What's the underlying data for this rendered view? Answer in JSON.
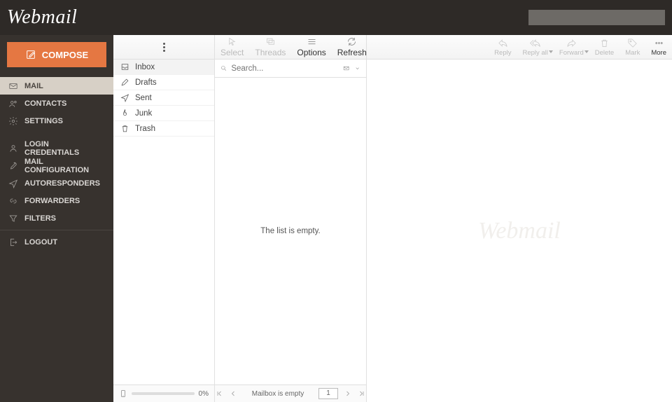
{
  "header": {
    "logo": "Webmail"
  },
  "compose": {
    "label": "COMPOSE"
  },
  "sidebar": {
    "primary": [
      {
        "label": "MAIL",
        "active": true
      },
      {
        "label": "CONTACTS"
      },
      {
        "label": "SETTINGS"
      }
    ],
    "secondary": [
      {
        "label": "LOGIN CREDENTIALS"
      },
      {
        "label": "MAIL CONFIGURATION"
      },
      {
        "label": "AUTORESPONDERS"
      },
      {
        "label": "FORWARDERS"
      },
      {
        "label": "FILTERS"
      }
    ],
    "logout": {
      "label": "LOGOUT"
    }
  },
  "folders": {
    "items": [
      {
        "label": "Inbox",
        "selected": true
      },
      {
        "label": "Drafts"
      },
      {
        "label": "Sent"
      },
      {
        "label": "Junk"
      },
      {
        "label": "Trash"
      }
    ],
    "quota": "0%"
  },
  "toolbar": {
    "left": [
      {
        "label": "Select",
        "icon": "cursor",
        "disabled": true
      },
      {
        "label": "Threads",
        "icon": "threads",
        "disabled": true
      },
      {
        "label": "Options",
        "icon": "options",
        "disabled": false
      },
      {
        "label": "Refresh",
        "icon": "refresh",
        "disabled": false
      }
    ],
    "right": [
      {
        "label": "Reply",
        "icon": "reply",
        "disabled": true
      },
      {
        "label": "Reply all",
        "icon": "replyall",
        "disabled": true,
        "caret": true
      },
      {
        "label": "Forward",
        "icon": "forward",
        "disabled": true,
        "caret": true
      },
      {
        "label": "Delete",
        "icon": "trash",
        "disabled": true
      },
      {
        "label": "Mark",
        "icon": "tag",
        "disabled": true
      },
      {
        "label": "More",
        "icon": "more",
        "disabled": false
      }
    ]
  },
  "search": {
    "placeholder": "Search..."
  },
  "list": {
    "empty": "The list is empty.",
    "status": "Mailbox is empty",
    "page": "1"
  },
  "preview": {
    "watermark": "Webmail"
  }
}
